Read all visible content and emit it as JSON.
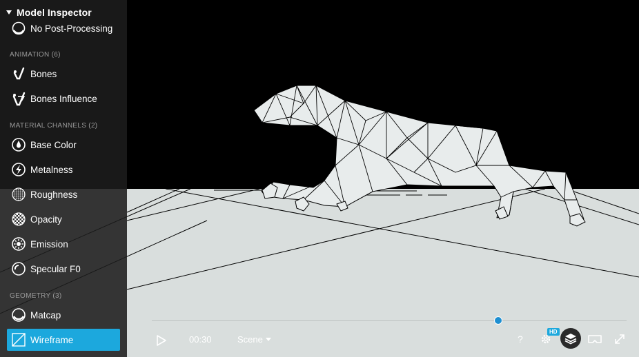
{
  "sidebar": {
    "title": "Model Inspector",
    "items_top": [
      {
        "label": "No Post-Processing",
        "icon": "post-processing-icon"
      }
    ],
    "sections": [
      {
        "label": "ANIMATION (6)"
      },
      {
        "label": "MATERIAL CHANNELS (2)"
      },
      {
        "label": "GEOMETRY (3)"
      }
    ],
    "animation_items": [
      {
        "label": "Bones",
        "icon": "bones-icon"
      },
      {
        "label": "Bones Influence",
        "icon": "bones-influence-icon"
      }
    ],
    "material_items": [
      {
        "label": "Base Color",
        "icon": "base-color-icon"
      },
      {
        "label": "Metalness",
        "icon": "metalness-icon"
      },
      {
        "label": "Roughness",
        "icon": "roughness-icon"
      },
      {
        "label": "Opacity",
        "icon": "opacity-icon"
      },
      {
        "label": "Emission",
        "icon": "emission-icon"
      },
      {
        "label": "Specular F0",
        "icon": "specular-icon"
      }
    ],
    "geometry_items": [
      {
        "label": "Matcap",
        "icon": "matcap-icon"
      },
      {
        "label": "Wireframe",
        "icon": "wireframe-icon",
        "active": true
      }
    ]
  },
  "player": {
    "time": "00:30",
    "scene_label": "Scene",
    "hd_badge": "HD",
    "progress": 0.73,
    "accent_color": "#1ca8dd"
  },
  "colors": {
    "ground": "#d9dedd",
    "background": "#000000",
    "active_item": "#1ca8dd"
  }
}
